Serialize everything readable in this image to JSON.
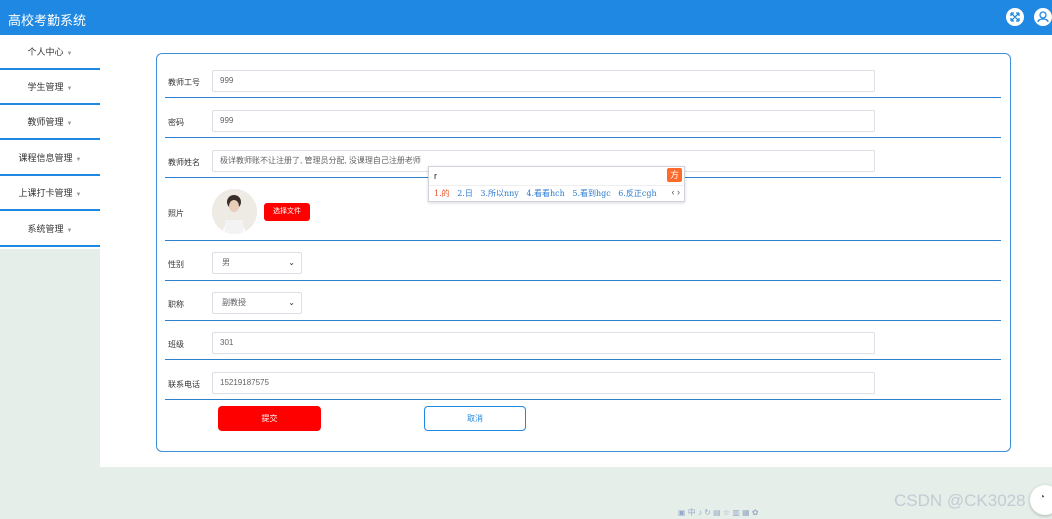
{
  "app": {
    "title": "高校考勤系统"
  },
  "header": {
    "icons": [
      "fullscreen-icon",
      "user-icon"
    ]
  },
  "sidebar": {
    "items": [
      {
        "label": "个人中心"
      },
      {
        "label": "学生管理"
      },
      {
        "label": "教师管理"
      },
      {
        "label": "课程信息管理"
      },
      {
        "label": "上课打卡管理"
      },
      {
        "label": "系统管理"
      }
    ]
  },
  "form": {
    "teacher_no": {
      "label": "教师工号",
      "value": "999"
    },
    "password": {
      "label": "密码",
      "value": "999"
    },
    "teacher_name": {
      "label": "教师姓名",
      "value": "极详教师账不让注册了, 管理员分配, 没课理自己注册老师"
    },
    "photo": {
      "label": "照片",
      "button": "选择文件"
    },
    "gender": {
      "label": "性别",
      "value": "男"
    },
    "title": {
      "label": "职称",
      "value": "副教授"
    },
    "class": {
      "label": "班级",
      "value": "301"
    },
    "phone": {
      "label": "联系电话",
      "value": "15219187575"
    },
    "submit": "提交",
    "cancel": "取消"
  },
  "ime": {
    "input": "r",
    "logo": "方",
    "candidates": [
      "1.的",
      "2.日",
      "3.所以nny",
      "4.看看hch",
      "5.看到hgc",
      "6.反正cgh"
    ],
    "arrows": "‹ ›"
  },
  "bottom_toolbar": "▣ 中 ♪ ↻ ▤ ☆ ▥ ▦ ✿",
  "watermark": "CSDN @CK3028",
  "float_button": "◔",
  "colors": {
    "primary": "#1f88e2",
    "danger": "#ff0000",
    "ime_accent": "#ff6a2b"
  }
}
